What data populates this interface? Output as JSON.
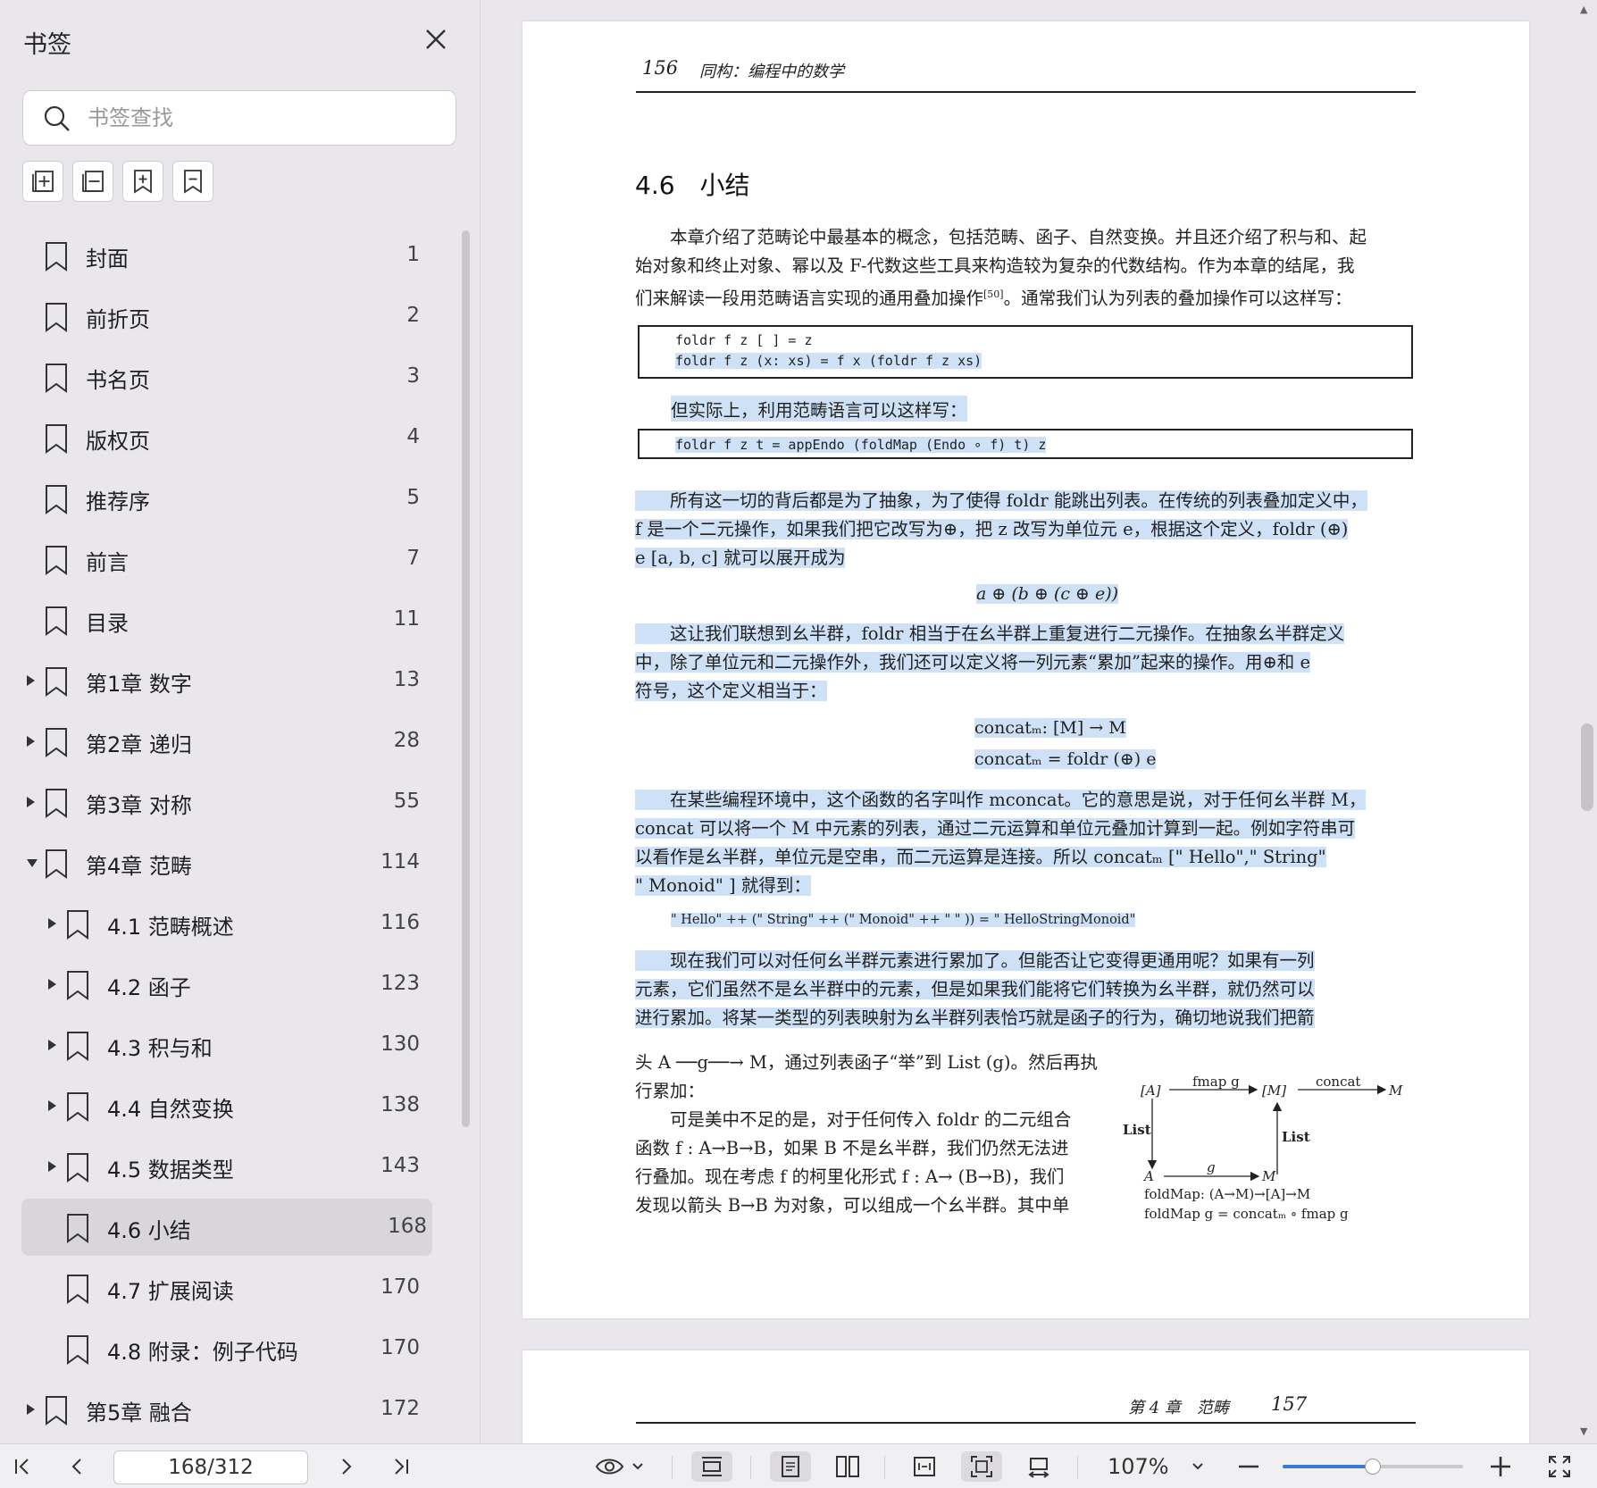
{
  "sidebar": {
    "title": "书签",
    "search_placeholder": "书签查找",
    "tools": [
      "expand-all-icon",
      "collapse-all-icon",
      "add-bookmark-icon",
      "remove-bookmark-icon"
    ],
    "bookmarks": [
      {
        "label": "封面",
        "page": "1",
        "level": 0,
        "arrow": "none"
      },
      {
        "label": "前折页",
        "page": "2",
        "level": 0,
        "arrow": "none"
      },
      {
        "label": "书名页",
        "page": "3",
        "level": 0,
        "arrow": "none"
      },
      {
        "label": "版权页",
        "page": "4",
        "level": 0,
        "arrow": "none"
      },
      {
        "label": "推荐序",
        "page": "5",
        "level": 0,
        "arrow": "none"
      },
      {
        "label": "前言",
        "page": "7",
        "level": 0,
        "arrow": "none"
      },
      {
        "label": "目录",
        "page": "11",
        "level": 0,
        "arrow": "none"
      },
      {
        "label": "第1章 数字",
        "page": "13",
        "level": 0,
        "arrow": "right"
      },
      {
        "label": "第2章 递归",
        "page": "28",
        "level": 0,
        "arrow": "right"
      },
      {
        "label": "第3章 对称",
        "page": "55",
        "level": 0,
        "arrow": "right"
      },
      {
        "label": "第4章 范畴",
        "page": "114",
        "level": 0,
        "arrow": "down"
      },
      {
        "label": "4.1 范畴概述",
        "page": "116",
        "level": 1,
        "arrow": "right"
      },
      {
        "label": "4.2 函子",
        "page": "123",
        "level": 1,
        "arrow": "right"
      },
      {
        "label": "4.3 积与和",
        "page": "130",
        "level": 1,
        "arrow": "right"
      },
      {
        "label": "4.4 自然变换",
        "page": "138",
        "level": 1,
        "arrow": "right"
      },
      {
        "label": "4.5 数据类型",
        "page": "143",
        "level": 1,
        "arrow": "right"
      },
      {
        "label": "4.6 小结",
        "page": "168",
        "level": 1,
        "arrow": "none",
        "active": true
      },
      {
        "label": "4.7 扩展阅读",
        "page": "170",
        "level": 1,
        "arrow": "none"
      },
      {
        "label": "4.8 附录：例子代码",
        "page": "170",
        "level": 1,
        "arrow": "none"
      },
      {
        "label": "第5章 融合",
        "page": "172",
        "level": 0,
        "arrow": "right"
      }
    ]
  },
  "page1": {
    "header_num": "156",
    "header_title": "同构：编程中的数学",
    "section_title": "4.6　小结",
    "p1": [
      "　　本章介绍了范畴论中最基本的概念，包括范畴、函子、自然变换。并且还介绍了积与和、起",
      "始对象和终止对象、幂以及 F-代数这些工具来构造较为复杂的代数结构。作为本章的结尾，我",
      "们来解读一段用范畴语言实现的通用叠加操作",
      "[50]",
      "。通常我们认为列表的叠加操作可以这样写："
    ],
    "code1": [
      "foldr f z [ ] = z",
      "foldr f z (x: xs) = f x (foldr f z xs)"
    ],
    "p2": "但实际上，利用范畴语言可以这样写：",
    "code2": "foldr f z t = appEndo (foldMap (Endo ∘ f) t) z",
    "p3": [
      "　　所有这一切的背后都是为了抽象，为了使得 foldr 能跳出列表。在传统的列表叠加定义中，",
      "f 是一个二元操作，如果我们把它改写为⊕，把 z 改写为单位元 e，根据这个定义，foldr (⊕)",
      "e [a, b, c] 就可以展开成为"
    ],
    "eq1": "a ⊕ (b ⊕ (c ⊕ e))",
    "p4": [
      "　　这让我们联想到幺半群，foldr 相当于在幺半群上重复进行二元操作。在抽象幺半群定义",
      "中，除了单位元和二元操作外，我们还可以定义将一列元素“累加”起来的操作。用⊕和 e",
      "符号，这个定义相当于："
    ],
    "eq2": "concatₘ: [M] → M",
    "eq3": "concatₘ = foldr (⊕) e",
    "p5": [
      "　　在某些编程环境中，这个函数的名字叫作 mconcat。它的意思是说，对于任何幺半群 M，",
      "concat 可以将一个 M 中元素的列表，通过二元运算和单位元叠加计算到一起。例如字符串可",
      "以看作是幺半群，单位元是空串，而二元运算是连接。所以 concatₘ [\" Hello\",\" String\"",
      "\" Monoid\" ] 就得到："
    ],
    "eq4": "\" Hello\" ++ (\" String\" ++ (\" Monoid\" ++ \" \" )) = \" HelloStringMonoid\"",
    "p6": [
      "　　现在我们可以对任何幺半群元素进行累加了。但能否让它变得更通用呢？如果有一列",
      "元素，它们虽然不是幺半群中的元素，但是如果我们能将它们转换为幺半群，就仍然可以",
      "进行累加。将某一类型的列表映射为幺半群列表恰巧就是函子的行为，确切地说我们把箭"
    ],
    "p7": [
      "头 A ──g──→ M，通过列表函子“举”到 List (g)。然后再执",
      "行累加：",
      "　　可是美中不足的是，对于任何传入 foldr 的二元组合",
      "函数 f : A→B→B，如果 B 不是幺半群，我们仍然无法进",
      "行叠加。现在考虑 f 的柯里化形式 f : A→ (B→B)，我们",
      "发现以箭头 B→B 为对象，可以组成一个幺半群。其中单"
    ],
    "diagram": {
      "a_list": "[A]",
      "fmap": "fmap g",
      "m_list": "[M]",
      "concat": "concat",
      "m_top": "M",
      "list_left": "List",
      "list_right": "List",
      "a": "A",
      "g": "g",
      "m_bottom": "M",
      "line1": "foldMap: (A→M)→[A]→M",
      "line2": "foldMap g = concatₘ ∘ fmap g"
    }
  },
  "page2": {
    "header_title": "第 4 章　范畴",
    "header_num": "157"
  },
  "bottombar": {
    "page_indicator": "168/312",
    "zoom": "107%",
    "zoom_fraction": 0.5
  },
  "colors": {
    "highlight": "#cfe1f7",
    "accent": "#3a7ad9"
  }
}
